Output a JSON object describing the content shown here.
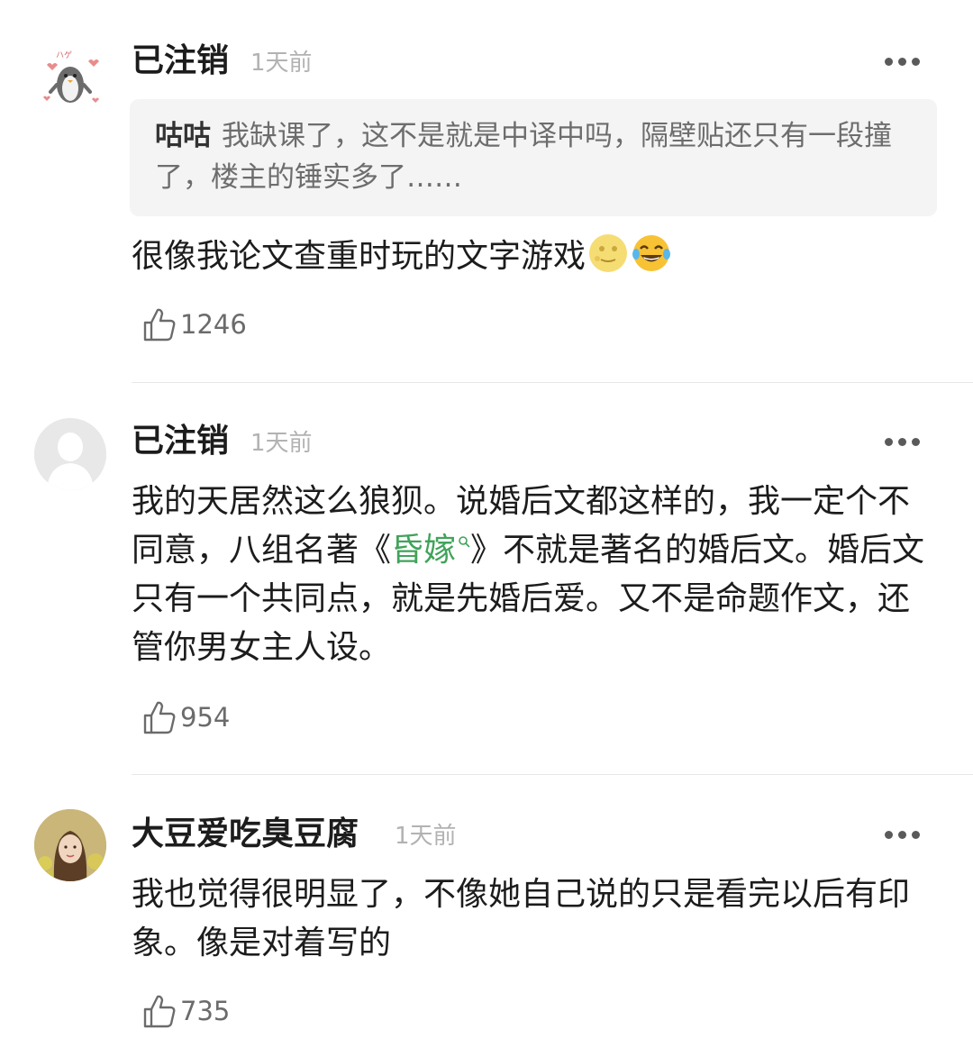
{
  "comments": [
    {
      "username": "已注销",
      "time": "1天前",
      "quote": {
        "author": "咕咕",
        "text": "我缺课了，这不是就是中译中吗，隔壁贴还只有一段撞了，楼主的锤实多了……"
      },
      "text": "很像我论文查重时玩的文字游戏",
      "emojis": [
        "moon-face-icon",
        "laughing-tears-icon"
      ],
      "likes": "1246"
    },
    {
      "username": "已注销",
      "time": "1天前",
      "text_before_link": "我的天居然这么狼狈。说婚后文都这样的，我一定个不同意，八组名著《",
      "link_text": "昏嫁",
      "text_after_link": "》不就是著名的婚后文。婚后文只有一个共同点，就是先婚后爱。又不是命题作文，还管你男女主人设。",
      "likes": "954"
    },
    {
      "username": "大豆爱吃臭豆腐",
      "time": "1天前",
      "text": "我也觉得很明显了，不像她自己说的只是看完以后有印象。像是对着写的",
      "likes": "735"
    }
  ],
  "colors": {
    "link": "#41a35a",
    "text": "#1c1c1c",
    "muted": "#b2b2b2",
    "quote_bg": "#f4f4f4"
  }
}
